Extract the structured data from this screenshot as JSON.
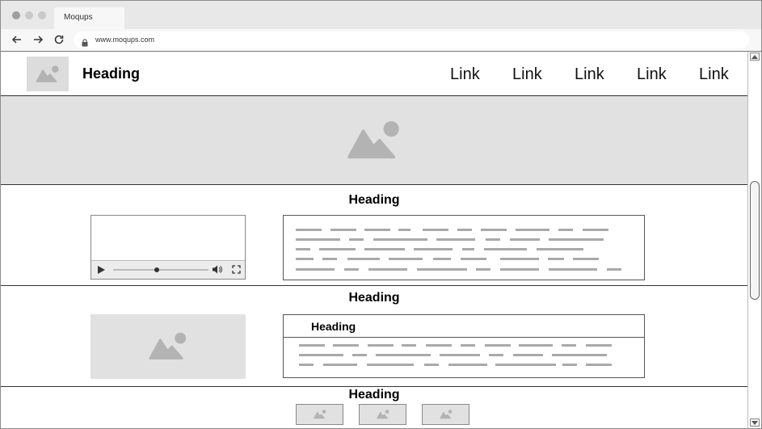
{
  "browser": {
    "tab_title": "Moqups",
    "url": "www.moqups.com",
    "icons": {
      "back": "arrow-left-icon",
      "forward": "arrow-right-icon",
      "reload": "reload-icon",
      "lock": "lock-icon"
    }
  },
  "header": {
    "heading": "Heading",
    "logo_icon": "image-placeholder-icon",
    "links": [
      "Link",
      "Link",
      "Link",
      "Link",
      "Link"
    ]
  },
  "hero": {
    "icon": "image-placeholder-icon"
  },
  "sections": [
    {
      "heading": "Heading",
      "media": {
        "type": "video",
        "controls": {
          "play": "play-icon",
          "volume": "volume-icon",
          "fullscreen": "fullscreen-icon"
        },
        "progress": 0.38
      },
      "text_block": "placeholder text lines"
    },
    {
      "heading": "Heading",
      "media": {
        "type": "image",
        "icon": "image-placeholder-icon"
      },
      "panel": {
        "title": "Heading"
      }
    },
    {
      "heading": "Heading",
      "thumbnails": [
        "image-placeholder-icon",
        "image-placeholder-icon",
        "image-placeholder-icon"
      ]
    }
  ],
  "colors": {
    "placeholder_fill": "#e1e1e1",
    "placeholder_line": "#a9a9a9",
    "icon": "#b3b3b3"
  }
}
